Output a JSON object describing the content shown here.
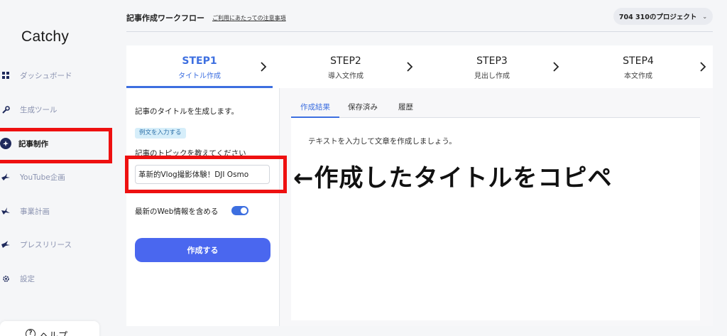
{
  "app": {
    "logo": "Catchy",
    "page_title": "記事作成ワークフロー",
    "notice_link": "ご利用にあたっての注意事項",
    "project_label": "704 310のプロジェクト"
  },
  "sidebar": {
    "items": [
      {
        "label": "ダッシュボード",
        "icon": "grid-icon",
        "active": false
      },
      {
        "label": "生成ツール",
        "icon": "wrench-icon",
        "active": false
      },
      {
        "label": "記事制作",
        "icon": "bird-icon",
        "active": true
      },
      {
        "label": "YouTube企画",
        "icon": "bird-icon",
        "active": false
      },
      {
        "label": "事業計画",
        "icon": "bird-icon",
        "active": false
      },
      {
        "label": "プレスリリース",
        "icon": "bird-icon",
        "active": false
      },
      {
        "label": "設定",
        "icon": "gear-icon",
        "active": false
      }
    ],
    "help_label": "ヘルプ"
  },
  "steps": [
    {
      "step": "STEP1",
      "label": "タイトル作成",
      "active": true
    },
    {
      "step": "STEP2",
      "label": "導入文作成",
      "active": false
    },
    {
      "step": "STEP3",
      "label": "見出し作成",
      "active": false
    },
    {
      "step": "STEP4",
      "label": "本文作成",
      "active": false
    }
  ],
  "form": {
    "intro": "記事のタイトルを生成します。",
    "example_chip": "例文を入力する",
    "topic_label": "記事のトピックを教えてください",
    "topic_value": "革新的Vlog撮影体験！DJI Osmo",
    "web_toggle_label": "最新のWeb情報を含める",
    "web_toggle_on": true,
    "submit_label": "作成する"
  },
  "output": {
    "tabs": [
      "作成結果",
      "保存済み",
      "履歴"
    ],
    "active_tab": 0,
    "placeholder": "テキストを入力して文章を作成しましょう。"
  },
  "annotation": {
    "text": "←作成したタイトルをコピペ",
    "color": "#ee1010"
  },
  "colors": {
    "accent": "#3d6fe0",
    "button": "#4a67ef",
    "sidebar_text": "#8a92b0"
  }
}
